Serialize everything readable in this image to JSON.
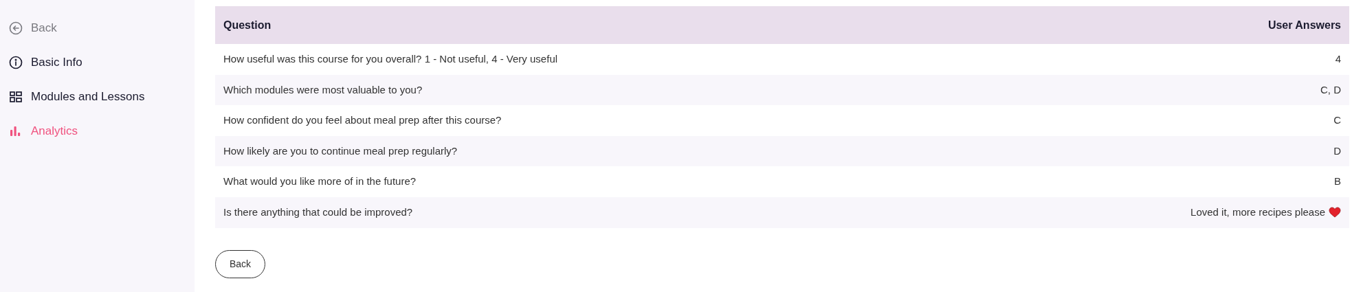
{
  "sidebar": {
    "items": [
      {
        "label": "Back",
        "kind": "back",
        "selected": false
      },
      {
        "label": "Basic Info",
        "kind": "info",
        "selected": false
      },
      {
        "label": "Modules and Lessons",
        "kind": "modules",
        "selected": false
      },
      {
        "label": "Analytics",
        "kind": "analytics",
        "selected": true
      }
    ]
  },
  "table": {
    "columns": [
      "Question",
      "User Answers"
    ],
    "rows": [
      {
        "question": "How useful was this course for you overall? 1 - Not useful, 4 - Very useful",
        "answer": "4"
      },
      {
        "question": "Which modules were most valuable to you?",
        "answer": "C, D"
      },
      {
        "question": "How confident do you feel about meal prep after this course?",
        "answer": "C"
      },
      {
        "question": "How likely are you to continue meal prep regularly?",
        "answer": "D"
      },
      {
        "question": "What would you like more of in the future?",
        "answer": "B"
      },
      {
        "question": "Is there anything that could be improved?",
        "answer": "Loved it, more recipes please",
        "heart": true
      }
    ]
  },
  "back_button": "Back"
}
